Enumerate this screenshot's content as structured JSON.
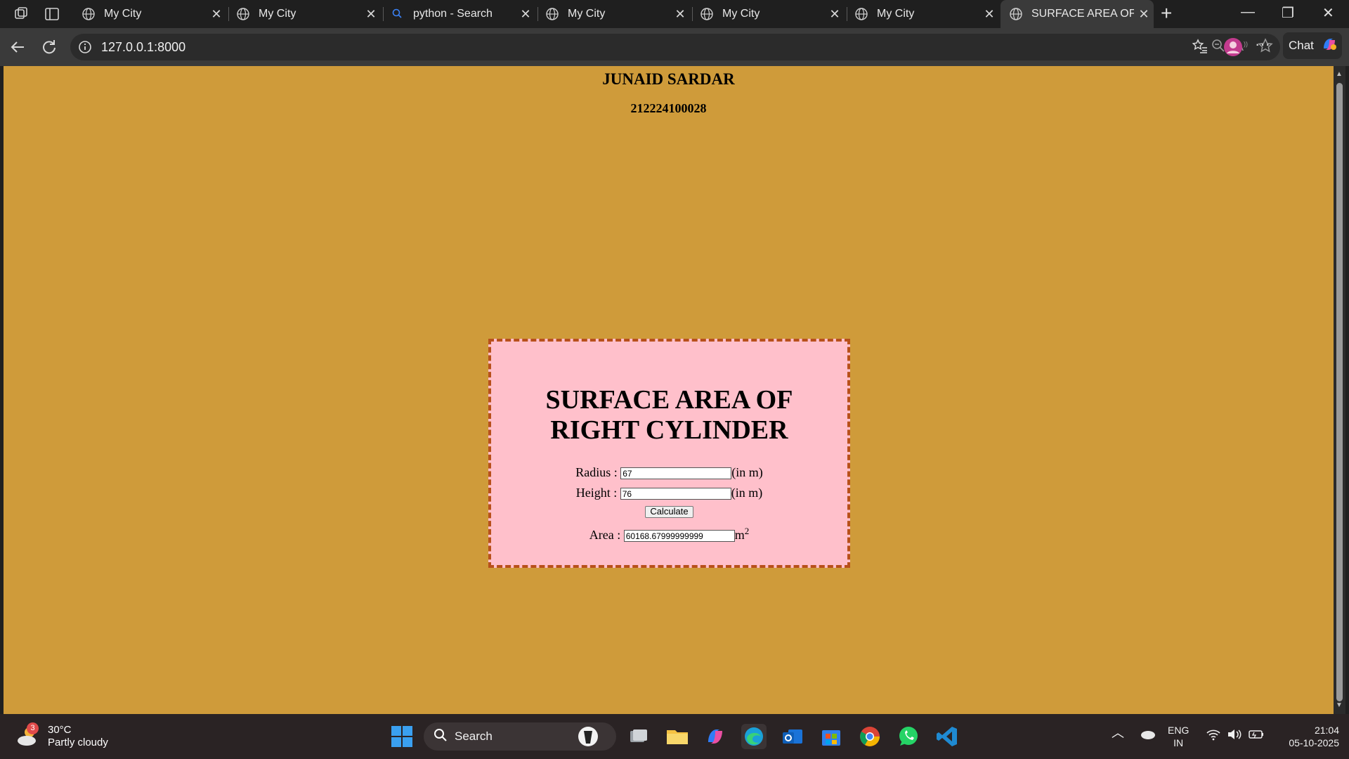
{
  "browser": {
    "tabs": [
      {
        "title": "My City",
        "icon": "globe-icon"
      },
      {
        "title": "My City",
        "icon": "globe-icon"
      },
      {
        "title": "python - Search",
        "icon": "search-icon"
      },
      {
        "title": "My City",
        "icon": "globe-icon"
      },
      {
        "title": "My City",
        "icon": "globe-icon"
      },
      {
        "title": "My City",
        "icon": "globe-icon"
      },
      {
        "title": "SURFACE AREA OF RI",
        "icon": "globe-icon",
        "active": true
      }
    ],
    "url": "127.0.0.1:8000",
    "chat_label": "Chat"
  },
  "page": {
    "name": "JUNAID SARDAR",
    "id_number": "212224100028",
    "background": "#cf9b3a",
    "card": {
      "heading_line1": "SURFACE AREA OF",
      "heading_line2": "RIGHT CYLINDER",
      "radius_label": "Radius :",
      "radius_value": "67",
      "radius_unit": "(in m)",
      "height_label": "Height :",
      "height_value": "76",
      "height_unit": "(in m)",
      "button_label": "Calculate",
      "area_label": "Area :",
      "area_value": "60168.67999999999",
      "area_unit": "m",
      "area_exponent": "2",
      "background": "#ffc0cb",
      "border_color": "#b8501a"
    }
  },
  "taskbar": {
    "weather_temp": "30°C",
    "weather_desc": "Partly cloudy",
    "weather_badge": "3",
    "search_label": "Search",
    "lang_top": "ENG",
    "lang_bottom": "IN",
    "time": "21:04",
    "date": "05-10-2025"
  }
}
